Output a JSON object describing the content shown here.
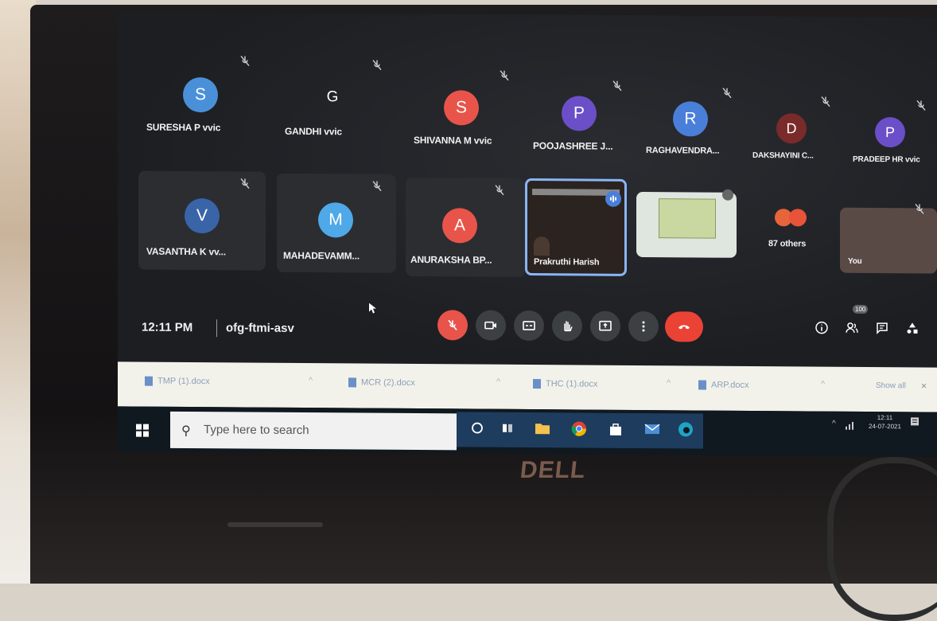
{
  "participants_row1": [
    {
      "initial": "S",
      "name": "SURESHA P vvic",
      "color": "#4a90d9"
    },
    {
      "initial": "G",
      "name": "GANDHI vvic",
      "color": "transparent"
    },
    {
      "initial": "S",
      "name": "SHIVANNA M vvic",
      "color": "#e8544a"
    },
    {
      "initial": "P",
      "name": "POOJASHREE J...",
      "color": "#6a4fc8"
    },
    {
      "initial": "R",
      "name": "RAGHAVENDRA...",
      "color": "#4a7fd9"
    },
    {
      "initial": "D",
      "name": "DAKSHAYINI C...",
      "color": "#7a2a2a"
    },
    {
      "initial": "P",
      "name": "PRADEEP HR vvic",
      "color": "#6a4fc8"
    }
  ],
  "participants_row2": [
    {
      "initial": "V",
      "name": "VASANTHA K vv...",
      "color": "#3a64a8"
    },
    {
      "initial": "M",
      "name": "MAHADEVAMM...",
      "color": "#4fa8e8"
    },
    {
      "initial": "A",
      "name": "ANURAKSHA BP...",
      "color": "#e8544a"
    },
    {
      "name": "Prakruthi Harish"
    },
    {
      "others_label": "87 others"
    },
    {
      "name": "You"
    }
  ],
  "controls": {
    "time": "12:11 PM",
    "meeting_code": "ofg-ftmi-asv",
    "participant_count": "100"
  },
  "downloads": [
    {
      "name": "TMP (1).docx"
    },
    {
      "name": "MCR (2).docx"
    },
    {
      "name": "THC (1).docx"
    },
    {
      "name": "ARP.docx"
    }
  ],
  "downloads_show_all": "Show all",
  "taskbar": {
    "search_placeholder": "Type here to search",
    "tray_time": "12:11",
    "tray_date": "24-07-2021"
  },
  "brand": "DELL",
  "colors": {
    "meet_bg": "#1d1f23",
    "end_call": "#ea4335",
    "mic_off": "#e8544a",
    "taskbar": "#101820"
  }
}
